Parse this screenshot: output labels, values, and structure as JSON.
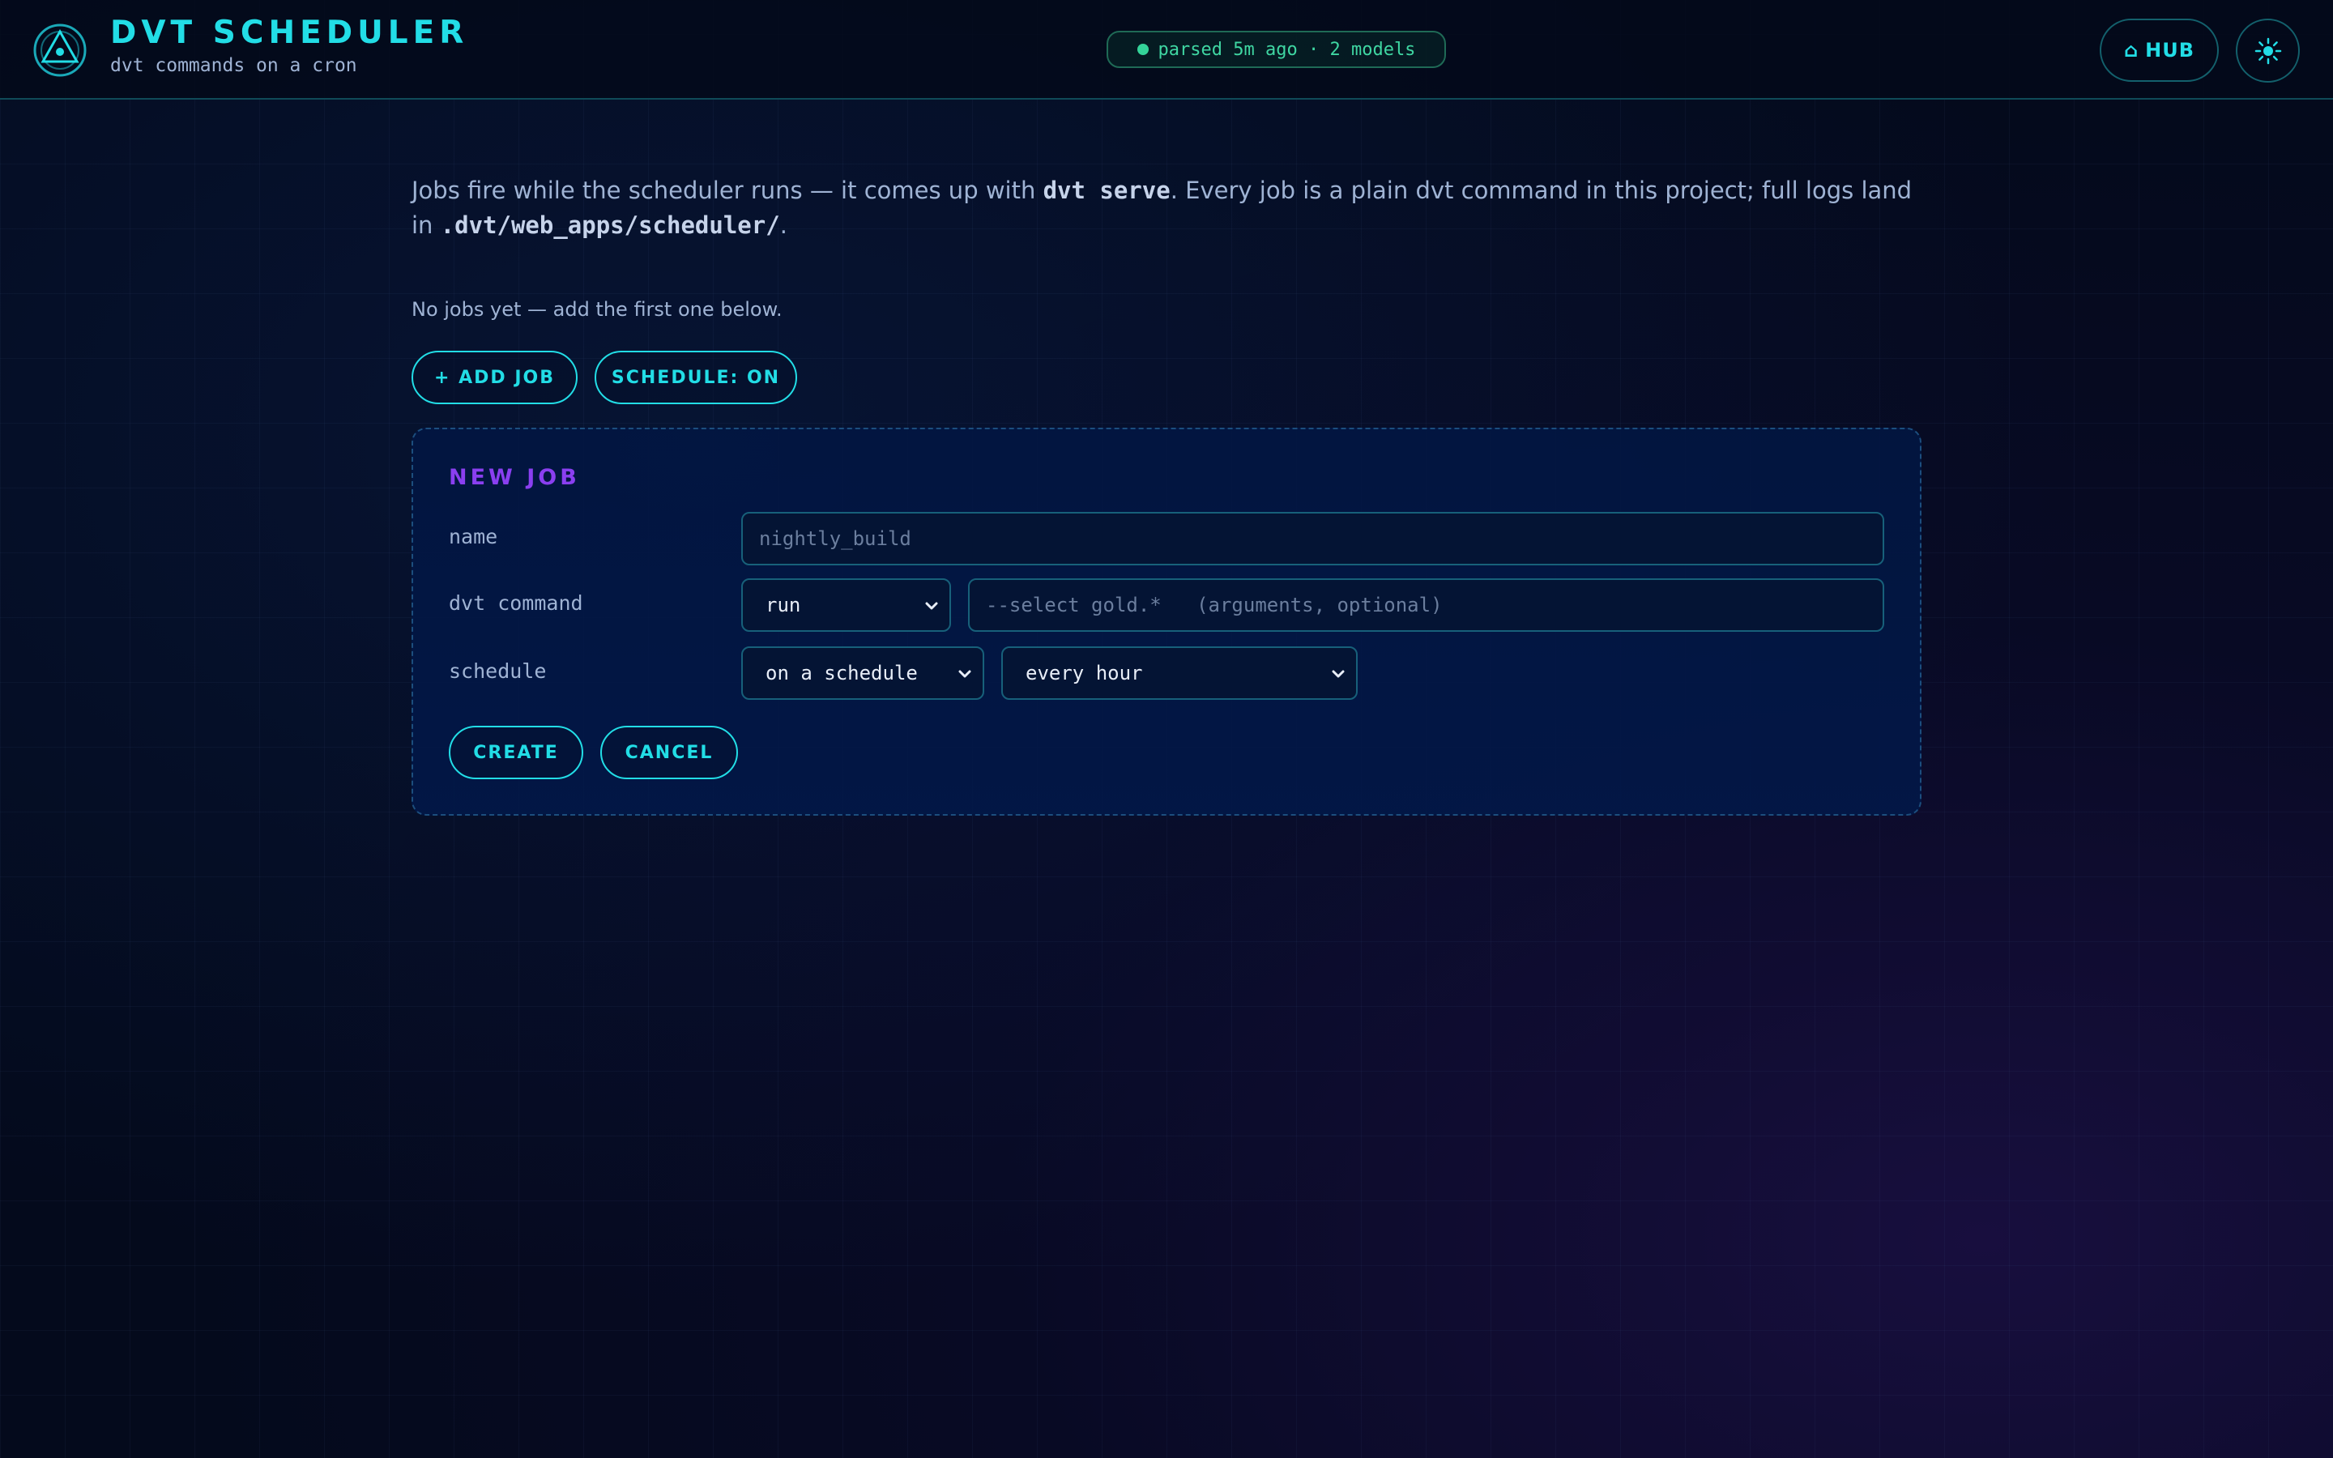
{
  "header": {
    "title": "DVT SCHEDULER",
    "subtitle": "dvt commands on a cron",
    "status": "parsed 5m ago · 2 models",
    "hub_icon": "⌂",
    "hub_label": "HUB",
    "theme_icon": "sun-icon"
  },
  "intro": {
    "part1": "Jobs fire while the scheduler runs — it comes up with ",
    "code1": "dvt serve",
    "part2": ". Every job is a plain dvt command in this project; full logs land in ",
    "code2": ".dvt/web_apps/scheduler/",
    "part3": "."
  },
  "empty_note": "No jobs yet — add the first one below.",
  "actions": {
    "add_job": "+ ADD JOB",
    "schedule_toggle": "SCHEDULE: ON"
  },
  "new_job": {
    "title": "NEW JOB",
    "name_label": "name",
    "name_placeholder": "nightly_build",
    "command_label": "dvt command",
    "command_selected": "run",
    "args_placeholder": "--select gold.*   (arguments, optional)",
    "schedule_label": "schedule",
    "schedule_mode": "on a schedule",
    "schedule_interval": "every hour",
    "create": "CREATE",
    "cancel": "CANCEL"
  },
  "colors": {
    "accent": "#22dde6",
    "panel_title": "#8a3ff0",
    "status_green": "#34d399",
    "background": "#040a1c"
  }
}
